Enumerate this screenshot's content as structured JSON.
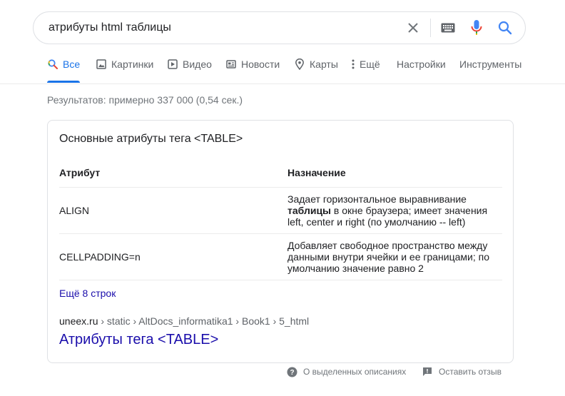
{
  "search": {
    "query": "атрибуты html таблицы",
    "clear_icon": "close-icon",
    "keyboard_icon": "keyboard-icon",
    "mic_icon": "microphone-icon",
    "search_icon": "search-icon"
  },
  "tabs": [
    {
      "label": "Все",
      "icon": "search-icon",
      "active": true
    },
    {
      "label": "Картинки",
      "icon": "image-icon"
    },
    {
      "label": "Видео",
      "icon": "video-icon"
    },
    {
      "label": "Новости",
      "icon": "news-icon"
    },
    {
      "label": "Карты",
      "icon": "map-pin-icon"
    },
    {
      "label": "Ещё",
      "icon": "more-vert-icon"
    },
    {
      "label": "Настройки"
    },
    {
      "label": "Инструменты"
    }
  ],
  "results_count": "Результатов: примерно 337 000 (0,54 сек.)",
  "snippet": {
    "title": "Основные атрибуты тега <TABLE>",
    "table": {
      "headers": [
        "Атрибут",
        "Назначение"
      ],
      "rows": [
        {
          "attr": "ALIGN",
          "desc_pre": "Задает горизонтальное выравнивание ",
          "desc_bold": "таблицы",
          "desc_post": " в окне браузера; имеет значения left, center и right (по умолчанию -- left)"
        },
        {
          "attr": "CELLPADDING=n",
          "desc_pre": "Добавляет свободное пространство между данными внутри ячейки и ее границами; по умолчанию значение равно 2",
          "desc_bold": "",
          "desc_post": ""
        }
      ]
    },
    "more_rows": "Ещё 8 строк",
    "breadcrumb_domain": "uneex.ru",
    "breadcrumb_path": " › static › AltDocs_informatika1 › Book1 › 5_html",
    "link_title": "Атрибуты тега <TABLE>"
  },
  "footer": {
    "about_label": "О выделенных описаниях",
    "feedback_label": "Оставить отзыв"
  },
  "colors": {
    "accent_blue": "#1a73e8",
    "link": "#1a0dab",
    "mic_red": "#ea4335"
  }
}
